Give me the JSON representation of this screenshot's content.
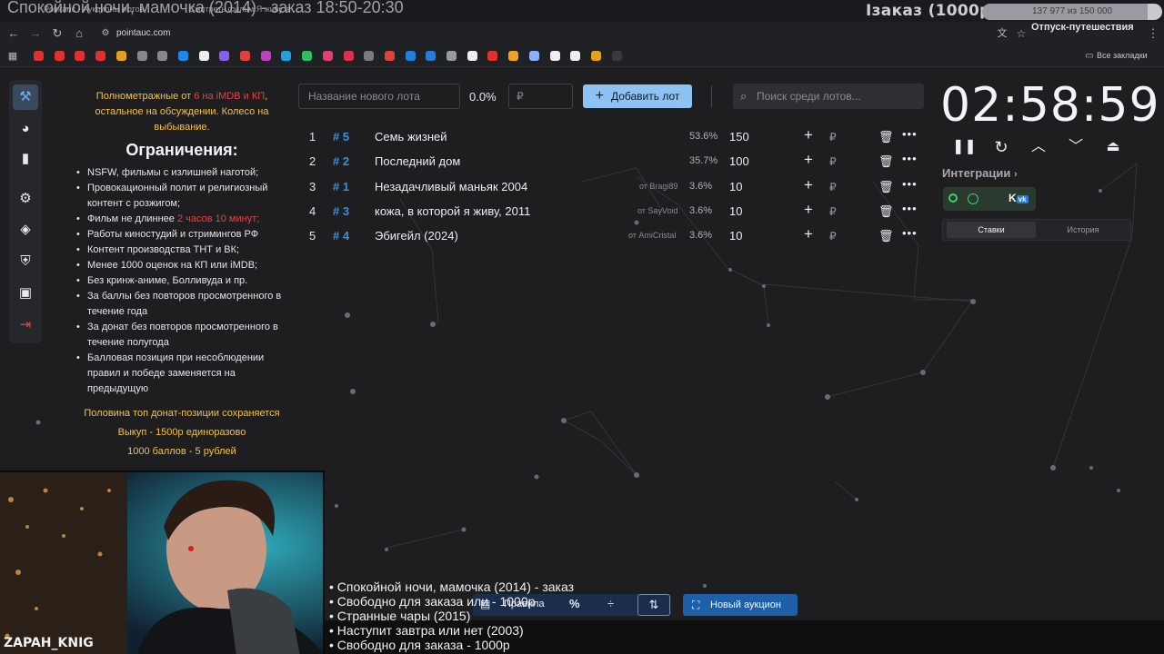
{
  "stream": {
    "title": "Спокойной ночи, мамочка (2014) - заказ 18:50-20:30",
    "order_badge": "Iзаказ (1000р)",
    "progress_text": "137 977 из 150 000",
    "progress_fraction": 0.92,
    "cam_name": "ZAPAH_KNIG"
  },
  "browser": {
    "tab_a": "Pointauc - Аукционы лотов",
    "tab_b": "Смотреть фильм Я живу, в ...",
    "url": "pointauc.com",
    "profile_label": "Отпуск-путешествия",
    "all_bookmarks": "Все закладки"
  },
  "rules": {
    "intro_before": "Полнометражные от ",
    "intro_red": "6 на iMDB и КП",
    "intro_after": ", остальное на обсуждении. Колесо на выбывание.",
    "heading": "Ограничения:",
    "items": [
      "NSFW, фильмы с излишней наготой;",
      "Провокационный полит и религиозный контент с розжигом;",
      "Фильм не длиннее ",
      "Работы киностудий и стримингов РФ",
      "Контент производства ТНТ и ВК;",
      "Менее 1000 оценок на КП или iMDB;",
      "Без кринж-аниме, Болливуда и пр.",
      "За баллы без повторов просмотренного в течение года",
      "За донат без повторов просмотренного в течение полугода",
      "Балловая позиция при несоблюдении правил и победе заменяется на предыдущую"
    ],
    "length_red": "2 часов 10 минут;",
    "foot": [
      "Половина топ донат-позиции сохраняется",
      "Выкуп - 1500р единоразово",
      "1000 баллов - 5 рублей"
    ]
  },
  "controls": {
    "lot_name_placeholder": "Название нового лота",
    "percent": "0.0%",
    "amount_placeholder": "₽",
    "add_lot": "Добавить лот",
    "search_placeholder": "Поиск среди лотов..."
  },
  "lots": [
    {
      "rank": "1",
      "id": "# 5",
      "name": "Семь жизней",
      "from": "",
      "pct": "53.6%",
      "amount": "150"
    },
    {
      "rank": "2",
      "id": "# 2",
      "name": "Последний дом",
      "from": "",
      "pct": "35.7%",
      "amount": "100"
    },
    {
      "rank": "3",
      "id": "# 1",
      "name": "Незадачливый маньяк 2004",
      "from": "от Bragi89",
      "pct": "3.6%",
      "amount": "10"
    },
    {
      "rank": "4",
      "id": "# 3",
      "name": "кожа, в которой я живу, 2011",
      "from": "от SayVoid",
      "pct": "3.6%",
      "amount": "10"
    },
    {
      "rank": "5",
      "id": "# 4",
      "name": "Эбигейл (2024)",
      "from": "от AmiCristal",
      "pct": "3.6%",
      "amount": "10"
    }
  ],
  "timer": {
    "value": "02:58:59",
    "integrations": "Интеграции",
    "tab_bets": "Ставки",
    "tab_history": "История"
  },
  "bottom": {
    "rules_btn": "Правила",
    "new_auction": "Новый аукцион"
  },
  "queue": [
    "• Спокойной ночи, мамочка (2014) - заказ",
    "• Свободно для заказа или - 1000р",
    "• Странные чары (2015)",
    "• Наступит завтра или нет (2003)",
    "• Свободно для заказа - 1000р"
  ],
  "colors": {
    "accent_blue": "#8ec2f2",
    "lot_id": "#3f8fd6",
    "warning_yellow": "#f1c14a",
    "red": "#e04545",
    "new_auction": "#1e5fa8"
  }
}
